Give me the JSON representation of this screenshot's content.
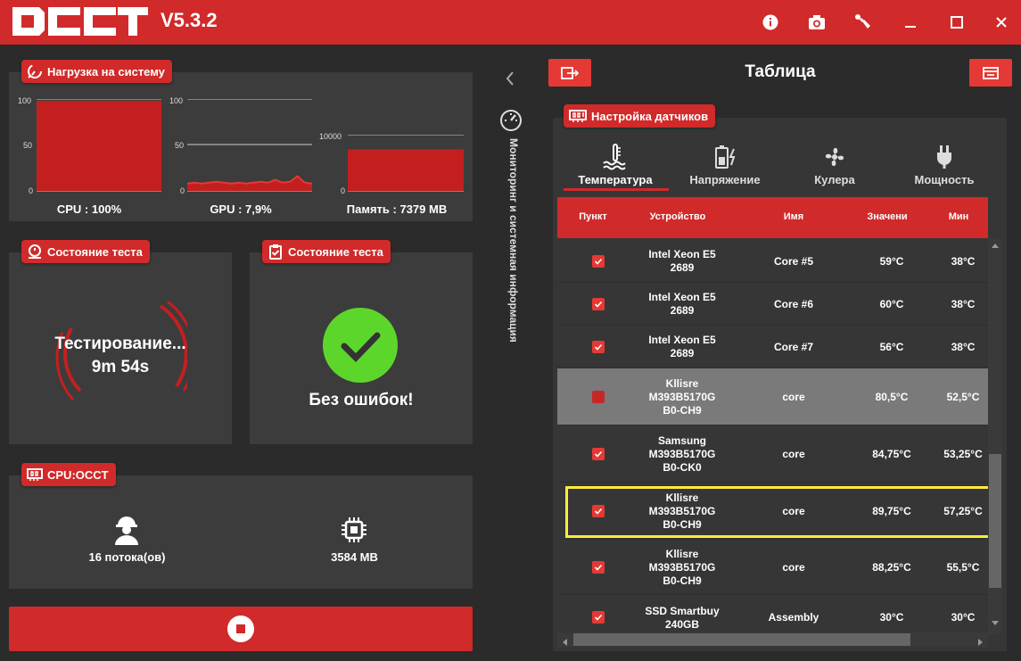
{
  "app": {
    "version": "V5.3.2"
  },
  "load_panel": {
    "title": "Нагрузка на систему",
    "cpu_label": "CPU : 100%",
    "gpu_label": "GPU : 7,9%",
    "mem_label": "Память : 7379 MB"
  },
  "chart_data": [
    {
      "type": "area",
      "title": "CPU : 100%",
      "ylim": [
        0,
        100
      ],
      "yticks": [
        "100",
        "50",
        "0"
      ],
      "values": [
        100,
        100,
        100,
        100,
        100,
        100,
        100,
        100,
        100,
        100
      ]
    },
    {
      "type": "line",
      "title": "GPU : 7,9%",
      "ylim": [
        0,
        100
      ],
      "yticks": [
        "100",
        "50",
        "0"
      ],
      "values": [
        8,
        9,
        8,
        9,
        10,
        9,
        8,
        9,
        8,
        9,
        10,
        9,
        12,
        9,
        10,
        16,
        9,
        8
      ]
    },
    {
      "type": "area",
      "title": "Память : 7379 MB",
      "ylim": [
        0,
        12000
      ],
      "yticks": [
        "10000",
        "0"
      ],
      "values": [
        7379,
        7379,
        7379,
        7379,
        7379,
        7379
      ]
    }
  ],
  "test_state_1": {
    "title": "Состояние теста",
    "status": "Тестирование...",
    "time": "9m 54s"
  },
  "test_state_2": {
    "title": "Состояние теста",
    "result": "Без ошибок!"
  },
  "cpu_occt": {
    "title": "CPU:OCCT",
    "threads": "16 потока(ов)",
    "memory": "3584 MB"
  },
  "sidebar": {
    "label": "Мониторинг и системная информация"
  },
  "table_panel": {
    "title": "Таблица",
    "sensors_badge": "Настройка датчиков",
    "tabs": [
      {
        "label": "Температура",
        "icon": "thermometer-icon",
        "active": true
      },
      {
        "label": "Напряжение",
        "icon": "battery-charge-icon",
        "active": false
      },
      {
        "label": "Кулера",
        "icon": "fan-icon",
        "active": false
      },
      {
        "label": "Мощность",
        "icon": "plug-icon",
        "active": false
      }
    ],
    "columns": [
      "Пункт",
      "Устройство",
      "Имя",
      "Значени",
      "Мин"
    ],
    "rows": [
      {
        "device": "Intel Xeon E5\n2689",
        "name": "Core #5",
        "value": "59°C",
        "min": "38°C"
      },
      {
        "device": "Intel Xeon E5\n2689",
        "name": "Core #6",
        "value": "60°C",
        "min": "38°C"
      },
      {
        "device": "Intel Xeon E5\n2689",
        "name": "Core #7",
        "value": "56°C",
        "min": "38°C"
      },
      {
        "device": "Kllisre\nM393B5170G\nB0-CH9",
        "name": "core",
        "value": "80,5°C",
        "min": "52,5°C"
      },
      {
        "device": "Samsung\nM393B5170G\nB0-CK0",
        "name": "core",
        "value": "84,75°C",
        "min": "53,25°C"
      },
      {
        "device": "Kllisre\nM393B5170G\nB0-CH9",
        "name": "core",
        "value": "89,75°C",
        "min": "57,25°C"
      },
      {
        "device": "Kllisre\nM393B5170G\nB0-CH9",
        "name": "core",
        "value": "88,25°C",
        "min": "55,5°C"
      },
      {
        "device": "SSD Smartbuy\n240GB",
        "name": "Assembly",
        "value": "30°C",
        "min": "30°C"
      }
    ]
  },
  "colors": {
    "accent": "#d12a2a",
    "panel": "#3c3c3c",
    "background": "#2b2b2b",
    "ok_green": "#5dd62c",
    "highlight": "#ffeb3b"
  }
}
